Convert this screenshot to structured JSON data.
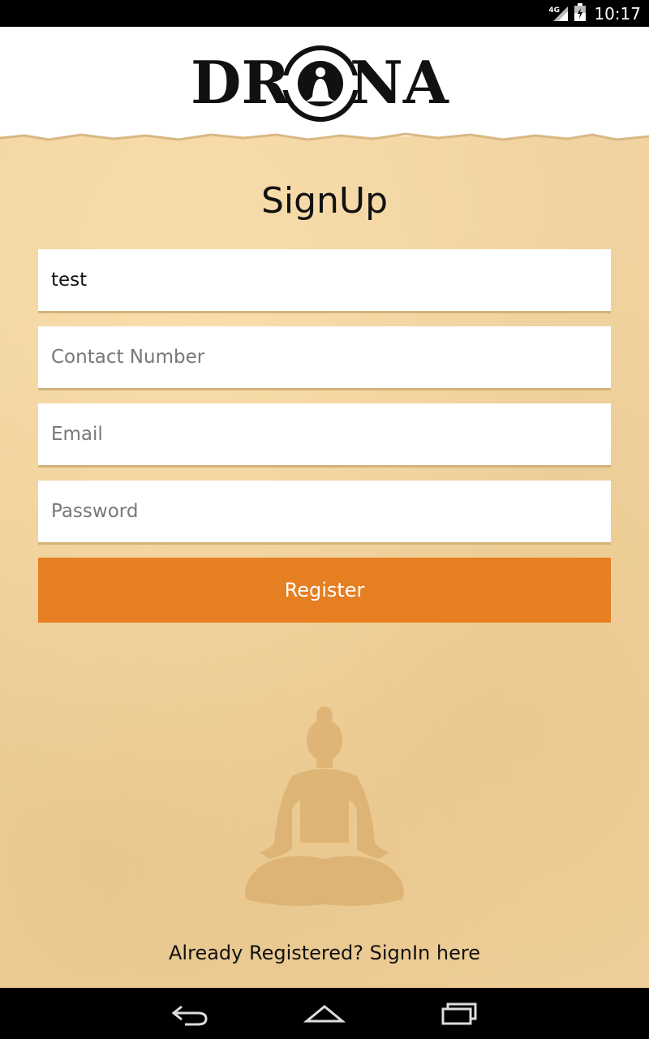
{
  "status_bar": {
    "network": "4G",
    "time": "10:17",
    "icons": [
      "signal-icon",
      "battery-icon"
    ]
  },
  "header": {
    "logo_text": "DRONA"
  },
  "form": {
    "title": "SignUp",
    "name_value": "test",
    "contact_placeholder": "Contact Number",
    "email_placeholder": "Email",
    "password_placeholder": "Password",
    "register_label": "Register"
  },
  "footer": {
    "signin_text": "Already Registered? SignIn here"
  },
  "navigation": {
    "icons": [
      "back-icon",
      "home-icon",
      "recents-icon"
    ]
  },
  "colors": {
    "accent": "#e67e22",
    "paper": "#f0d3a0",
    "field_underline": "#d4b27a"
  }
}
